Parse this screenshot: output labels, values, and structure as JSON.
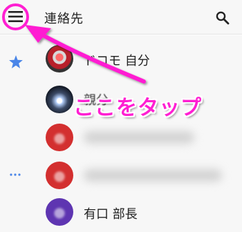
{
  "header": {
    "title": "連絡先",
    "menu_icon": "hamburger-menu-icon",
    "search_icon": "search-icon"
  },
  "sidebar": {
    "favorites_icon": "star-icon",
    "more_icon": "more-dots-icon",
    "accent_color": "#4a86e8"
  },
  "contacts": [
    {
      "name": "ドコモ 自分",
      "avatar": "photo"
    },
    {
      "name": "親分",
      "avatar": "photo"
    },
    {
      "name": "",
      "avatar": "red-letter"
    },
    {
      "name": "",
      "avatar": "red-letter"
    },
    {
      "name": "有口 部長",
      "avatar": "purple-letter"
    }
  ],
  "annotation": {
    "text": "ここをタップ",
    "color": "#ff1fd2"
  }
}
